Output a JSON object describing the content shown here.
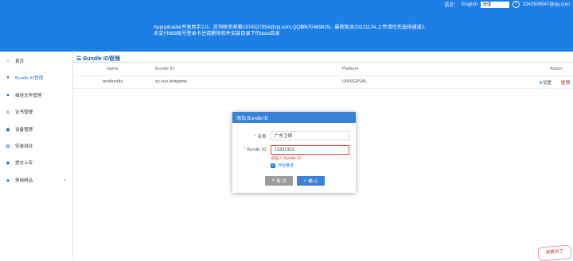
{
  "header": {
    "lang_prefix": "语言：",
    "lang_link": "English",
    "select_value": "管理",
    "user": "2242509547@qq.com",
    "notice_line1": "Appuploader开发助手2.0，咨询联系邮箱1974527954@qq.com,QQ群670469829。最新版本20221124,上传请优先选择通道2,",
    "notice_line2": "未支付688账号登录卡住请删除软件安装目录下的data目录"
  },
  "sidebar": {
    "items": [
      {
        "label": "首页",
        "icon": "home-icon",
        "glyph": "⌂"
      },
      {
        "label": "Bundle ID管理",
        "icon": "id-icon",
        "glyph": "●"
      },
      {
        "label": "描述文件管理",
        "icon": "profile-icon",
        "glyph": "▲"
      },
      {
        "label": "证书管理",
        "icon": "certificate-icon",
        "glyph": "◎"
      },
      {
        "label": "设备管理",
        "icon": "device-icon",
        "glyph": "▣"
      },
      {
        "label": "安装测试",
        "icon": "install-icon",
        "glyph": "▤"
      },
      {
        "label": "提交上传",
        "icon": "upload-icon",
        "glyph": "◉"
      },
      {
        "label": "常用网站",
        "icon": "website-icon",
        "glyph": "◈",
        "chevron": "∨"
      }
    ]
  },
  "main": {
    "title": "Bundle ID管理",
    "columns": [
      "Name",
      "Bundle ID",
      "Platform",
      "Action"
    ],
    "rows": [
      {
        "name": "testbundle",
        "bundle_id": "so.cuo.testgame",
        "platform": "UNIVERSAL",
        "action1": "设置",
        "action2": "删"
      }
    ]
  },
  "modal": {
    "title": "添加 Bundle ID",
    "name_label": "名称:",
    "name_value": "广东卫视",
    "bundle_label": "Bundle ID:",
    "bundle_value": "13231313",
    "error": "请输入 Bundle ID",
    "checkbox_label": "开始推送",
    "cancel": "取 消",
    "ok": "确 认"
  },
  "stamp": "我要到了"
}
